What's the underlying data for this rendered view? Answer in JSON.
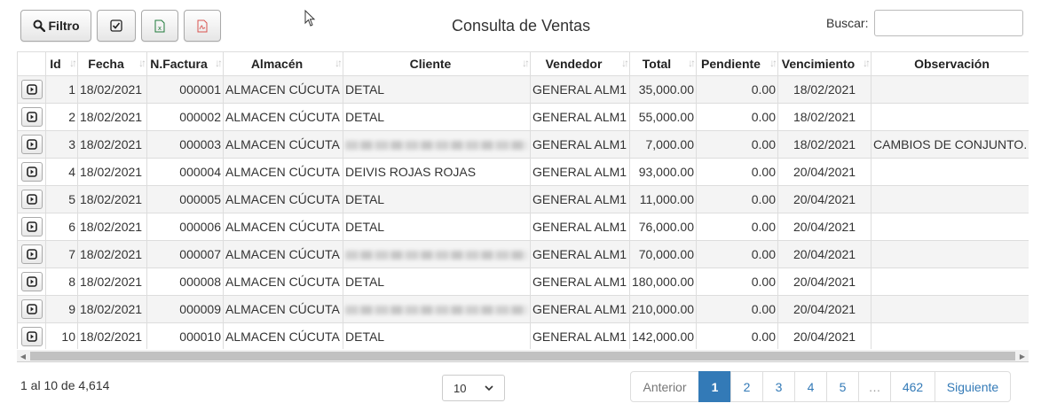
{
  "toolbar": {
    "filter_label": "Filtro"
  },
  "title": "Consulta de Ventas",
  "search": {
    "label": "Buscar:",
    "value": "",
    "placeholder": ""
  },
  "table": {
    "columns": [
      "Id",
      "Fecha",
      "N.Factura",
      "Almacén",
      "Cliente",
      "Vendedor",
      "Total",
      "Pendiente",
      "Vencimiento",
      "Observación"
    ],
    "rows": [
      {
        "id": "1",
        "fecha": "18/02/2021",
        "factura": "000001",
        "almacen": "ALMACEN CÚCUTA",
        "cliente": "DETAL",
        "cliente_redacted": false,
        "vendedor": "GENERAL ALM1",
        "total": "35,000.00",
        "pendiente": "0.00",
        "vencimiento": "18/02/2021",
        "observacion": ""
      },
      {
        "id": "2",
        "fecha": "18/02/2021",
        "factura": "000002",
        "almacen": "ALMACEN CÚCUTA",
        "cliente": "DETAL",
        "cliente_redacted": false,
        "vendedor": "GENERAL ALM1",
        "total": "55,000.00",
        "pendiente": "0.00",
        "vencimiento": "18/02/2021",
        "observacion": ""
      },
      {
        "id": "3",
        "fecha": "18/02/2021",
        "factura": "000003",
        "almacen": "ALMACEN CÚCUTA",
        "cliente": "",
        "cliente_redacted": true,
        "vendedor": "GENERAL ALM1",
        "total": "7,000.00",
        "pendiente": "0.00",
        "vencimiento": "18/02/2021",
        "observacion": "CAMBIOS DE CONJUNTO."
      },
      {
        "id": "4",
        "fecha": "18/02/2021",
        "factura": "000004",
        "almacen": "ALMACEN CÚCUTA",
        "cliente": "DEIVIS ROJAS ROJAS",
        "cliente_redacted": false,
        "vendedor": "GENERAL ALM1",
        "total": "93,000.00",
        "pendiente": "0.00",
        "vencimiento": "20/04/2021",
        "observacion": ""
      },
      {
        "id": "5",
        "fecha": "18/02/2021",
        "factura": "000005",
        "almacen": "ALMACEN CÚCUTA",
        "cliente": "DETAL",
        "cliente_redacted": false,
        "vendedor": "GENERAL ALM1",
        "total": "11,000.00",
        "pendiente": "0.00",
        "vencimiento": "20/04/2021",
        "observacion": ""
      },
      {
        "id": "6",
        "fecha": "18/02/2021",
        "factura": "000006",
        "almacen": "ALMACEN CÚCUTA",
        "cliente": "DETAL",
        "cliente_redacted": false,
        "vendedor": "GENERAL ALM1",
        "total": "76,000.00",
        "pendiente": "0.00",
        "vencimiento": "20/04/2021",
        "observacion": ""
      },
      {
        "id": "7",
        "fecha": "18/02/2021",
        "factura": "000007",
        "almacen": "ALMACEN CÚCUTA",
        "cliente": "",
        "cliente_redacted": true,
        "vendedor": "GENERAL ALM1",
        "total": "70,000.00",
        "pendiente": "0.00",
        "vencimiento": "20/04/2021",
        "observacion": ""
      },
      {
        "id": "8",
        "fecha": "18/02/2021",
        "factura": "000008",
        "almacen": "ALMACEN CÚCUTA",
        "cliente": "DETAL",
        "cliente_redacted": false,
        "vendedor": "GENERAL ALM1",
        "total": "180,000.00",
        "pendiente": "0.00",
        "vencimiento": "20/04/2021",
        "observacion": ""
      },
      {
        "id": "9",
        "fecha": "18/02/2021",
        "factura": "000009",
        "almacen": "ALMACEN CÚCUTA",
        "cliente": "",
        "cliente_redacted": true,
        "vendedor": "GENERAL ALM1",
        "total": "210,000.00",
        "pendiente": "0.00",
        "vencimiento": "20/04/2021",
        "observacion": ""
      },
      {
        "id": "10",
        "fecha": "18/02/2021",
        "factura": "000010",
        "almacen": "ALMACEN CÚCUTA",
        "cliente": "DETAL",
        "cliente_redacted": false,
        "vendedor": "GENERAL ALM1",
        "total": "142,000.00",
        "pendiente": "0.00",
        "vencimiento": "20/04/2021",
        "observacion": ""
      }
    ]
  },
  "footer": {
    "info": "1 al 10 de 4,614",
    "page_size": "10"
  },
  "pagination": {
    "prev": "Anterior",
    "pages": [
      "1",
      "2",
      "3",
      "4",
      "5",
      "…",
      "462"
    ],
    "active": "1",
    "next": "Siguiente"
  },
  "colors": {
    "accent": "#337ab7",
    "excel": "#1f7a3a",
    "pdf": "#d9534f"
  }
}
